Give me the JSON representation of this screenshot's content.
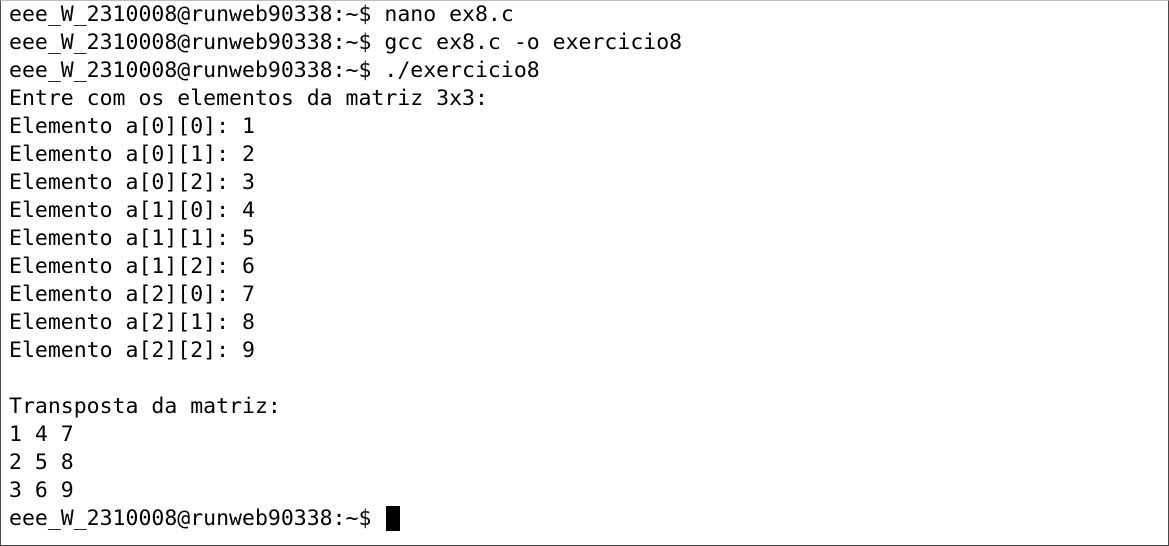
{
  "terminal": {
    "lines": [
      "eee_W_2310008@runweb90338:~$ nano ex8.c",
      "eee_W_2310008@runweb90338:~$ gcc ex8.c -o exercicio8",
      "eee_W_2310008@runweb90338:~$ ./exercicio8",
      "Entre com os elementos da matriz 3x3:",
      "Elemento a[0][0]: 1",
      "Elemento a[0][1]: 2",
      "Elemento a[0][2]: 3",
      "Elemento a[1][0]: 4",
      "Elemento a[1][1]: 5",
      "Elemento a[1][2]: 6",
      "Elemento a[2][0]: 7",
      "Elemento a[2][1]: 8",
      "Elemento a[2][2]: 9",
      "",
      "Transposta da matriz:",
      "1 4 7",
      "2 5 8",
      "3 6 9"
    ],
    "prompt": "eee_W_2310008@runweb90338:~$ "
  }
}
